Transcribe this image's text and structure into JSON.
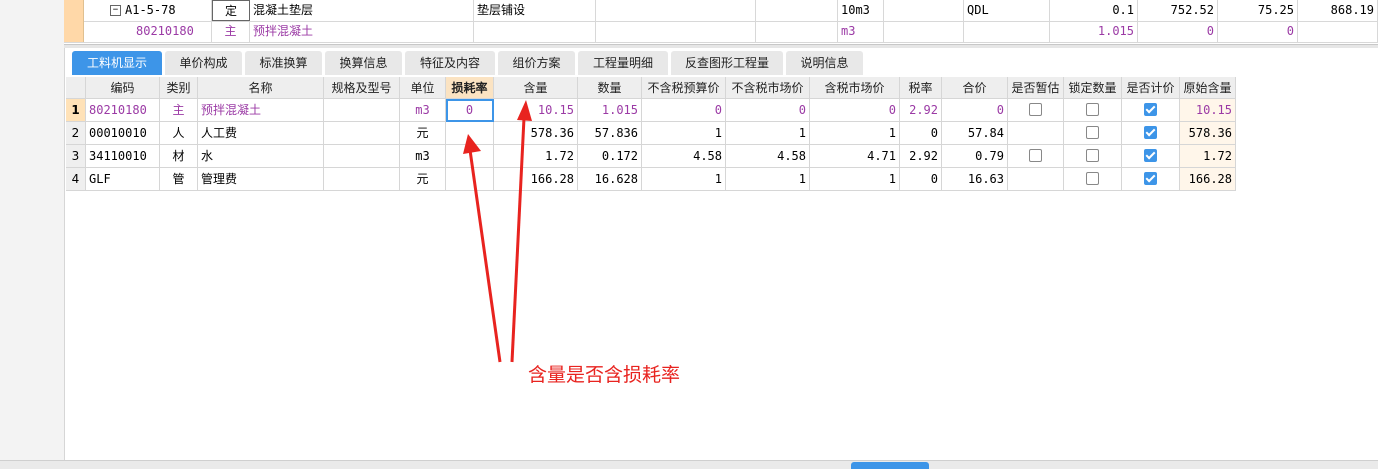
{
  "top_row": {
    "code": "A1-5-78",
    "type": "定",
    "name": "混凝土垫层",
    "desc": "垫层铺设",
    "unit": "10m3",
    "mark": "QDL",
    "v1": "0.1",
    "v2": "752.52",
    "v3": "75.25",
    "v4": "868.19"
  },
  "sub_row": {
    "code": "80210180",
    "type": "主",
    "name": "预拌混凝土",
    "unit": "m3",
    "v1": "1.015",
    "v2": "0",
    "v3": "0"
  },
  "tabs": [
    "工料机显示",
    "单价构成",
    "标准换算",
    "换算信息",
    "特征及内容",
    "组价方案",
    "工程量明细",
    "反查图形工程量",
    "说明信息"
  ],
  "headers": [
    "编码",
    "类别",
    "名称",
    "规格及型号",
    "单位",
    "损耗率",
    "含量",
    "数量",
    "不含税预算价",
    "不含税市场价",
    "含税市场价",
    "税率",
    "合价",
    "是否暂估",
    "锁定数量",
    "是否计价",
    "原始含量"
  ],
  "rows": [
    {
      "num": "1",
      "code": "80210180",
      "cat": "主",
      "name": "预拌混凝土",
      "spec": "",
      "unit": "m3",
      "loss": "0",
      "content": "10.15",
      "qty": "1.015",
      "budget": "0",
      "market": "0",
      "market_tax": "0",
      "tax": "2.92",
      "total": "0",
      "est": "false",
      "lock": "false",
      "priced": "true",
      "orig": "10.15"
    },
    {
      "num": "2",
      "code": "00010010",
      "cat": "人",
      "name": "人工费",
      "spec": "",
      "unit": "元",
      "loss": "",
      "content": "578.36",
      "qty": "57.836",
      "budget": "1",
      "market": "1",
      "market_tax": "1",
      "tax": "0",
      "total": "57.84",
      "est": "",
      "lock": "false",
      "priced": "true",
      "orig": "578.36"
    },
    {
      "num": "3",
      "code": "34110010",
      "cat": "材",
      "name": "水",
      "spec": "",
      "unit": "m3",
      "loss": "",
      "content": "1.72",
      "qty": "0.172",
      "budget": "4.58",
      "market": "4.58",
      "market_tax": "4.71",
      "tax": "2.92",
      "total": "0.79",
      "est": "false",
      "lock": "false",
      "priced": "true",
      "orig": "1.72"
    },
    {
      "num": "4",
      "code": "GLF",
      "cat": "管",
      "name": "管理费",
      "spec": "",
      "unit": "元",
      "loss": "",
      "content": "166.28",
      "qty": "16.628",
      "budget": "1",
      "market": "1",
      "market_tax": "1",
      "tax": "0",
      "total": "16.63",
      "est": "",
      "lock": "false",
      "priced": "true",
      "orig": "166.28"
    }
  ],
  "annotation": "含量是否含损耗率",
  "colors": {
    "accent": "#3d95e8",
    "annotation": "#e8231f",
    "purple": "#9b3aa5"
  }
}
